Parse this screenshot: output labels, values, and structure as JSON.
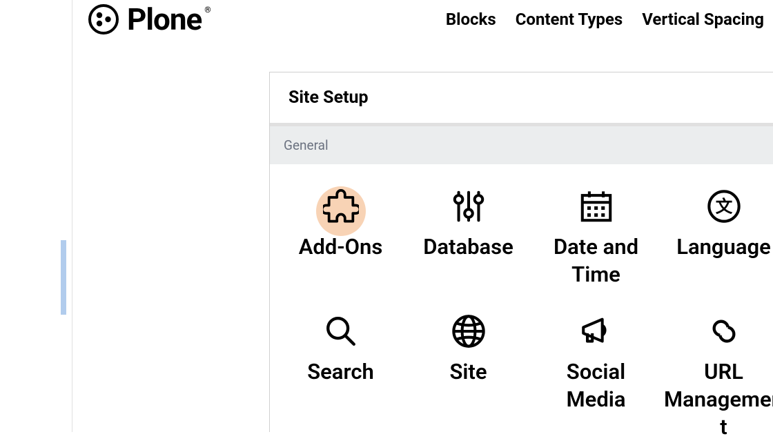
{
  "brand": {
    "name": "Plone"
  },
  "nav": {
    "items": [
      {
        "label": "Blocks"
      },
      {
        "label": "Content Types"
      },
      {
        "label": "Vertical Spacing"
      }
    ]
  },
  "panel": {
    "title": "Site Setup",
    "section_label": "General",
    "tiles": [
      {
        "icon": "puzzle-icon",
        "label": "Add-Ons",
        "highlighted": true
      },
      {
        "icon": "sliders-icon",
        "label": "Database"
      },
      {
        "icon": "calendar-icon",
        "label": "Date and Time"
      },
      {
        "icon": "language-icon",
        "label": "Language"
      },
      {
        "icon": "search-icon",
        "label": "Search"
      },
      {
        "icon": "globe-icon",
        "label": "Site"
      },
      {
        "icon": "megaphone-icon",
        "label": "Social Media"
      },
      {
        "icon": "link-icon",
        "label": "URL Management"
      }
    ]
  }
}
